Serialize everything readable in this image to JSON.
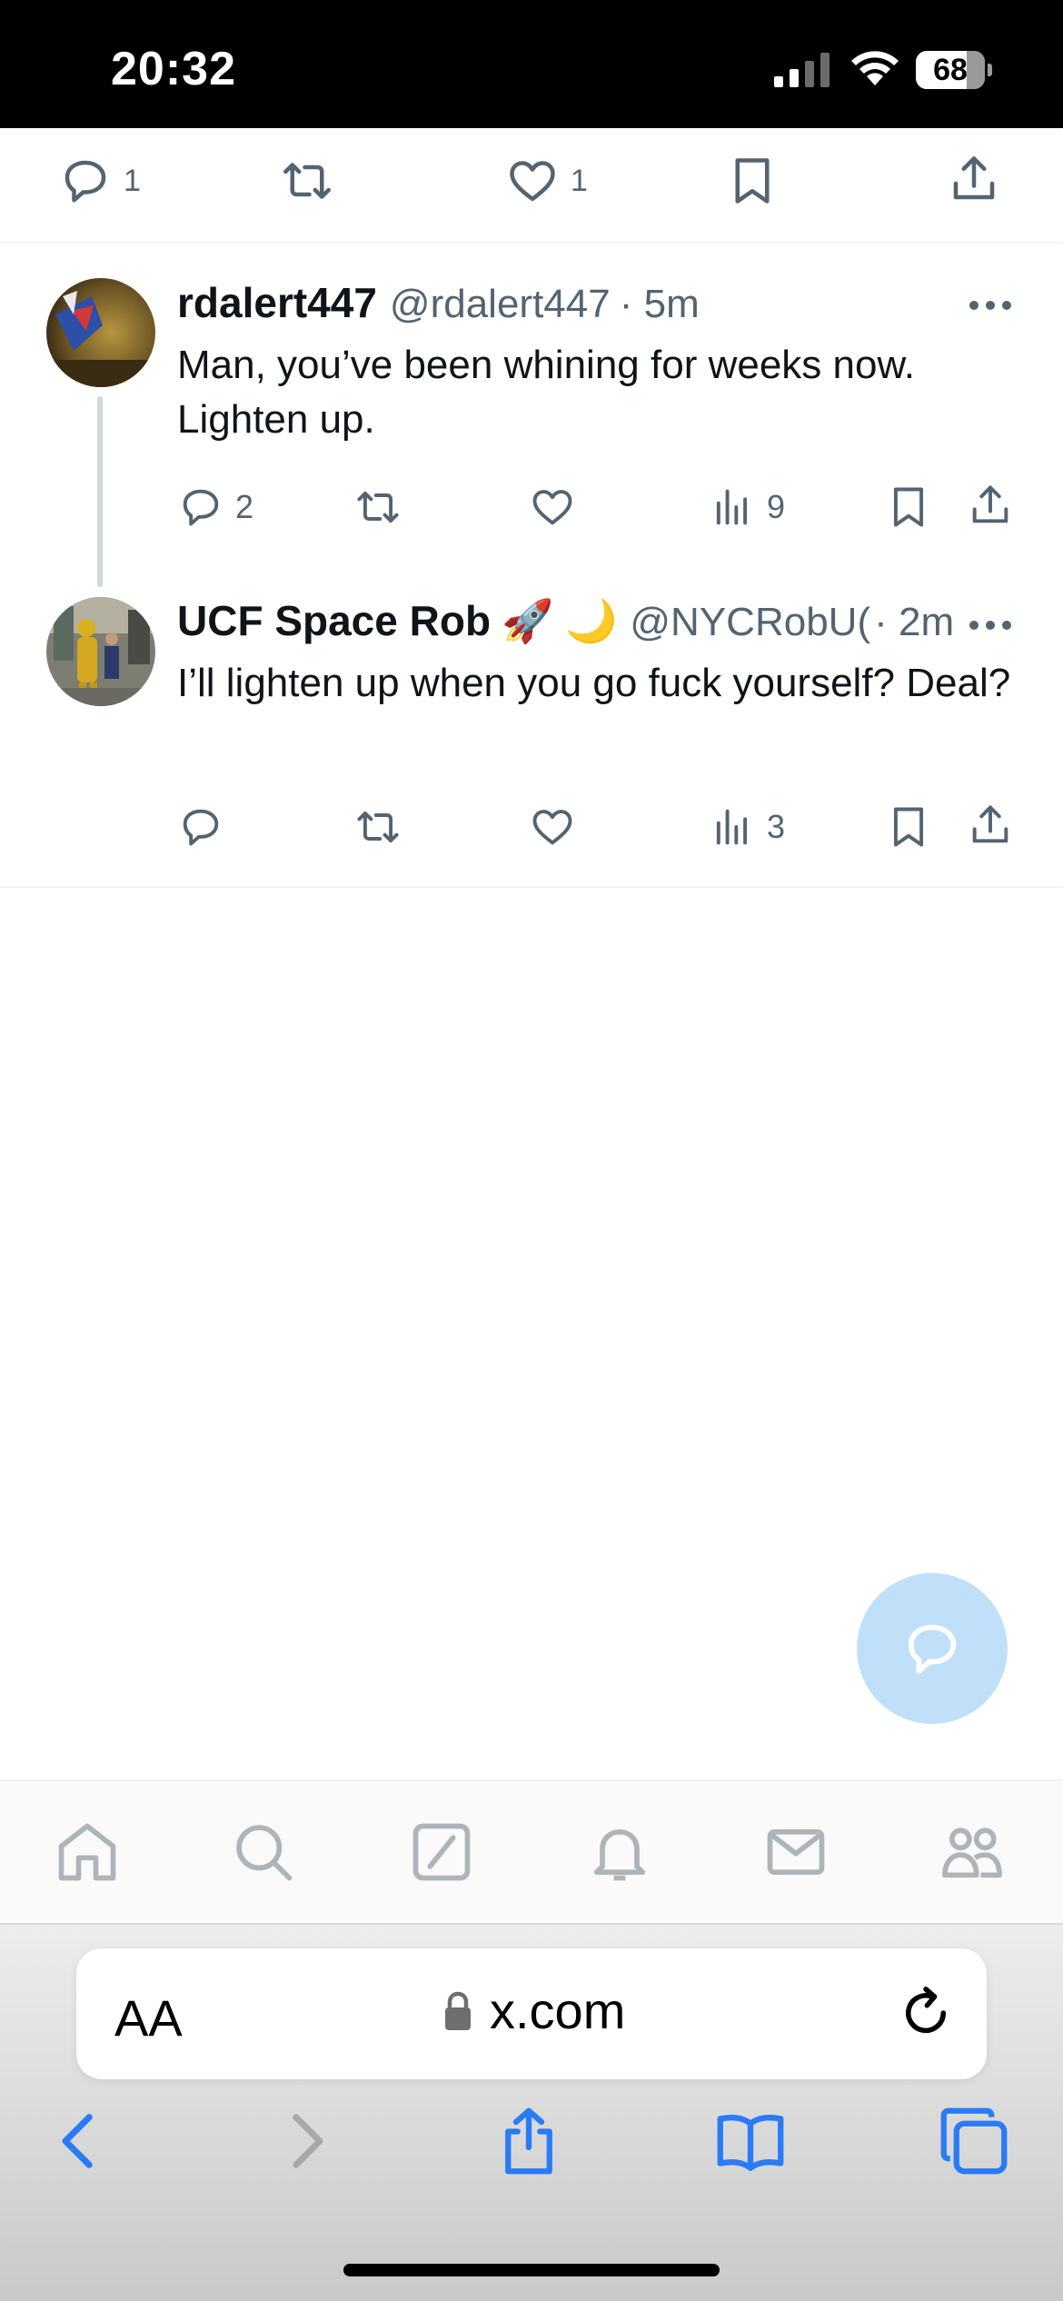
{
  "status_bar": {
    "time": "20:32",
    "battery": "68",
    "icons": [
      "cellular-signal-icon",
      "wifi-icon",
      "battery-icon"
    ]
  },
  "parent_tweet_actions": {
    "replies": "1",
    "likes": "1",
    "icons": [
      "reply-icon",
      "retweet-icon",
      "like-icon",
      "bookmark-icon",
      "share-icon"
    ]
  },
  "tweets": [
    {
      "name": "rdalert447",
      "handle": "@rdalert447",
      "time": "· 5m",
      "emoji": "",
      "text": "Man, you’ve been whining for weeks now. Lighten up.",
      "replies": "2",
      "views": "9"
    },
    {
      "name": "UCF Space Rob",
      "handle": "@NYCRobU(",
      "time": "· 2m",
      "emoji": "🚀 🌙",
      "text": "I’ll lighten up when you go fuck yourself? Deal?",
      "replies": "",
      "views": "3"
    }
  ],
  "tab_bar": {
    "items": [
      "home-icon",
      "search-icon",
      "grok-icon",
      "notifications-icon",
      "messages-icon",
      "communities-icon"
    ]
  },
  "browser": {
    "text_size_label": "AA",
    "url": "x.com"
  },
  "colors": {
    "secondary_text": "#536471",
    "primary_text": "#0f1419",
    "fab": "#bfe0f8",
    "safari_blue": "#2a7bf6"
  }
}
